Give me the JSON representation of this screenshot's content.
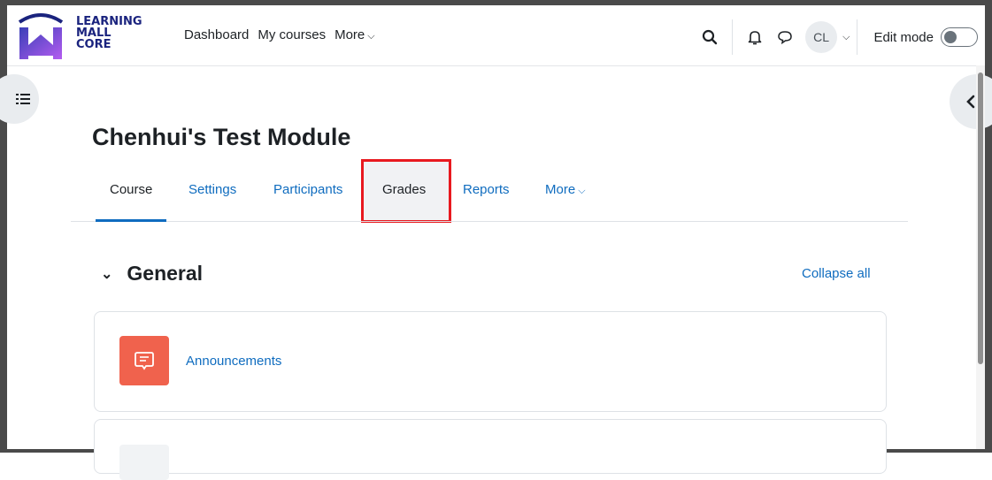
{
  "logo": {
    "line1": "LEARNING",
    "line2": "MALL",
    "line3": "CORE"
  },
  "primary_nav": {
    "dashboard": "Dashboard",
    "my_courses": "My courses",
    "more": "More"
  },
  "user": {
    "initials": "CL"
  },
  "edit_mode": {
    "label": "Edit mode",
    "enabled": false
  },
  "course": {
    "title": "Chenhui's Test Module"
  },
  "secondary_nav": {
    "tabs": [
      "Course",
      "Settings",
      "Participants",
      "Grades",
      "Reports",
      "More"
    ],
    "active": "Course",
    "highlighted": "Grades"
  },
  "section": {
    "title": "General",
    "collapse_all": "Collapse all"
  },
  "activities": [
    {
      "name": "Announcements",
      "icon": "forum-icon"
    }
  ],
  "colors": {
    "link": "#0f6cbf",
    "forum": "#f0624d",
    "highlight": "#e8191f",
    "logo_purple": "#7c3aed"
  },
  "icons": [
    "search-icon",
    "bell-icon",
    "chat-icon",
    "chevron-down-icon",
    "toggle-switch",
    "index-drawer-icon",
    "chevron-left-icon"
  ]
}
